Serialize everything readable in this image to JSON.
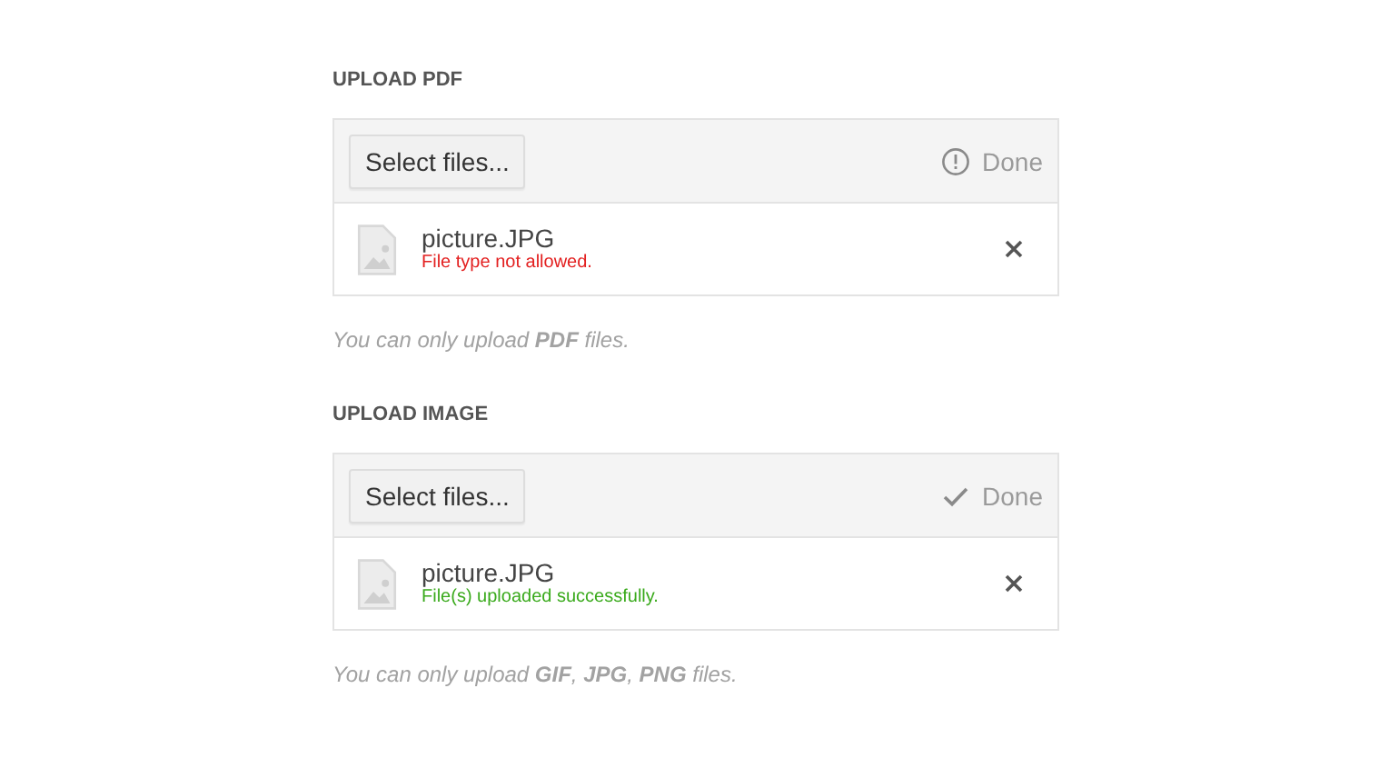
{
  "uploaders": [
    {
      "heading": "UPLOAD PDF",
      "button": "Select files...",
      "status": {
        "kind": "error",
        "label": "Done"
      },
      "files": [
        {
          "name": "picture.JPG",
          "message": "File type not allowed.",
          "kind": "error"
        }
      ],
      "hint": "You can only upload **PDF** files."
    },
    {
      "heading": "UPLOAD IMAGE",
      "button": "Select files...",
      "status": {
        "kind": "success",
        "label": "Done"
      },
      "files": [
        {
          "name": "picture.JPG",
          "message": "File(s) uploaded successfully.",
          "kind": "success"
        }
      ],
      "hint": "You can only upload **GIF**, **JPG**, **PNG** files."
    }
  ]
}
